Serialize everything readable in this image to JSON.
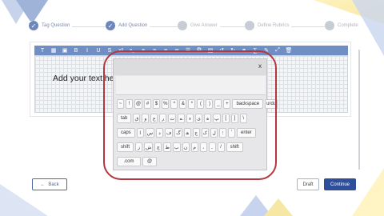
{
  "stepper": {
    "steps": [
      {
        "label": "Tag Question",
        "status": "done"
      },
      {
        "label": "Add Question",
        "status": "done"
      },
      {
        "label": "Give Answer",
        "status": "todo"
      },
      {
        "label": "Define Rubrics",
        "status": "todo"
      },
      {
        "label": "Complete",
        "status": "todo"
      }
    ]
  },
  "editor": {
    "placeholder_text": "Add your text here"
  },
  "keyboard": {
    "close_label": "x",
    "rows": [
      [
        "~",
        "!",
        "@",
        "#",
        "$",
        "%",
        "^",
        "&",
        "*",
        "(",
        ")",
        "_",
        "+",
        "backspace",
        "urdu"
      ],
      [
        "tab",
        "ق",
        "و",
        "ع",
        "ر",
        "ت",
        "ے",
        "ء",
        "ی",
        "ہ",
        "پ",
        "[",
        "]",
        "\\"
      ],
      [
        "caps",
        "ا",
        "س",
        "د",
        "ف",
        "گ",
        "ھ",
        "ج",
        "ک",
        "ل",
        "؛",
        "'",
        "enter"
      ],
      [
        "shift",
        "ز",
        "ش",
        "چ",
        "ط",
        "ب",
        "ن",
        "م",
        "،",
        "۔",
        "/",
        "shift"
      ],
      [
        ".com",
        "@"
      ]
    ]
  },
  "buttons": {
    "back_label": "Back",
    "back_arrow": "←",
    "draft_label": "Draft",
    "continue_label": "Continue"
  },
  "colors": {
    "toolbar": "#6f8fc4",
    "primary": "#2f4f9a",
    "highlight": "#b2373f"
  }
}
